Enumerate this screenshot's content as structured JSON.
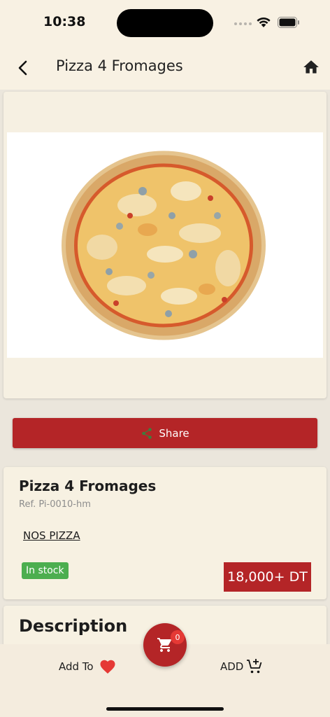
{
  "status_bar": {
    "time": "10:38"
  },
  "app_bar": {
    "title": "Pizza 4 Fromages"
  },
  "share": {
    "label": "Share"
  },
  "product": {
    "name": "Pizza 4 Fromages",
    "ref": "Ref. Pi-0010-hm",
    "category": "NOS PIZZA",
    "stock": "In stock",
    "price": "18,000+ DT"
  },
  "description": {
    "title": "Description"
  },
  "bottom_bar": {
    "add_to_label": "Add To",
    "add_label": "ADD",
    "cart_count": "0"
  },
  "colors": {
    "accent": "#b42527",
    "background": "#ebe6dc",
    "card": "#f7f1e2",
    "stock_green": "#4cae4f"
  },
  "icons": [
    "back-icon",
    "home-icon",
    "share-icon",
    "heart-icon",
    "cart-plus-icon",
    "cart-icon"
  ]
}
